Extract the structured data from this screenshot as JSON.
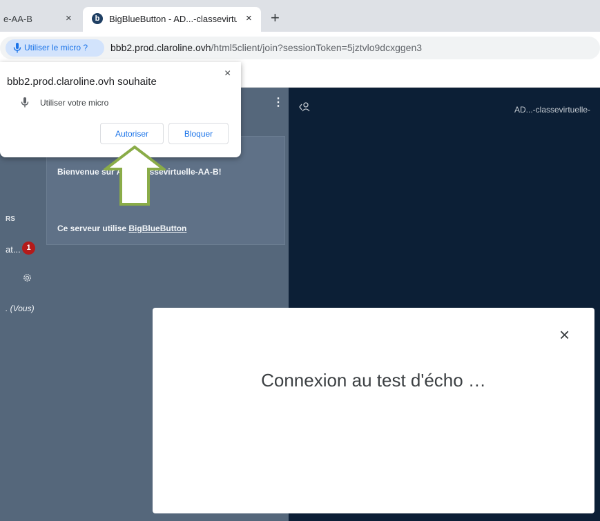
{
  "browser": {
    "tabs": [
      {
        "label": "e-AA-B",
        "close": "×"
      },
      {
        "label": "BigBlueButton - AD...-classevirtuelle",
        "favicon": "b",
        "close": "×"
      }
    ],
    "new_tab": "+",
    "mic_chip_label": "Utiliser le micro ?",
    "url_host": "bbb2.prod.claroline.ovh",
    "url_path": "/html5client/join?sessionToken=5jztvlo9dcxggen3"
  },
  "permission_popup": {
    "title": "bbb2.prod.claroline.ovh souhaite",
    "permission_label": "Utiliser votre micro",
    "close": "×",
    "allow_label": "Autoriser",
    "block_label": "Bloquer"
  },
  "sidebar": {
    "section_fragment": "RS",
    "chat_fragment": "at...",
    "chat_badge": "1",
    "user_fragment": ". (Vous)"
  },
  "chat_panel": {
    "welcome": "Bienvenue sur AD...-classevirtuelle-AA-B!",
    "server_prefix": "Ce serveur utilise ",
    "server_link": "BigBlueButton"
  },
  "main": {
    "title": "AD...-classevirtuelle-"
  },
  "modal": {
    "message": "Connexion au test d'écho …",
    "close": "×"
  },
  "icons": {
    "mic": "mic-icon",
    "gear": "gear-icon",
    "user": "user-icon",
    "arrow": "up-arrow-annotation"
  },
  "colors": {
    "bbb_panel": "#55677b",
    "bbb_main": "#0c1f36",
    "chrome_blue": "#1a73e8",
    "arrow_green": "#8aac48",
    "badge_red": "#b41a1a"
  }
}
